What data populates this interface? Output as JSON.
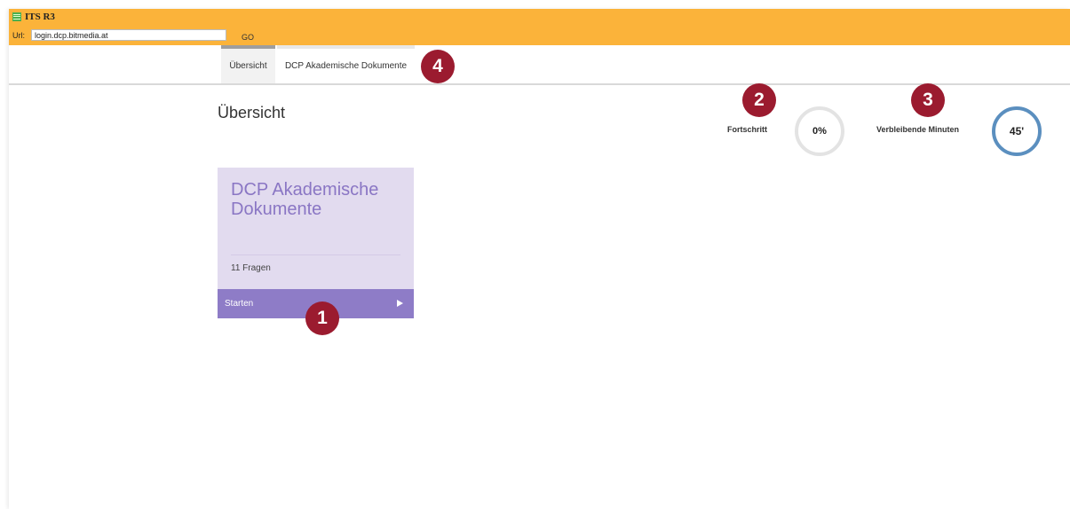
{
  "app": {
    "title": "ITS R3",
    "url_label": "Url:",
    "url_value": "login.dcp.bitmedia.at",
    "go_label": "GO"
  },
  "tabs": [
    {
      "label": "Übersicht"
    },
    {
      "label": "DCP Akademische Dokumente"
    }
  ],
  "main": {
    "title": "Übersicht",
    "progress": {
      "label": "Fortschritt",
      "value": "0%"
    },
    "minutes": {
      "label": "Verbleibende Minuten",
      "value": "45'"
    }
  },
  "card": {
    "title": "DCP Akademische Dokumente",
    "subtitle": "11 Fragen",
    "start_label": "Starten"
  },
  "markers": [
    "1",
    "2",
    "3",
    "4"
  ],
  "colors": {
    "topbar": "#fbb33a",
    "card_bg": "#e2dbef",
    "card_accent": "#8e7cc7",
    "marker": "#9b1b2f",
    "minutes_ring": "#5b8fbf"
  }
}
